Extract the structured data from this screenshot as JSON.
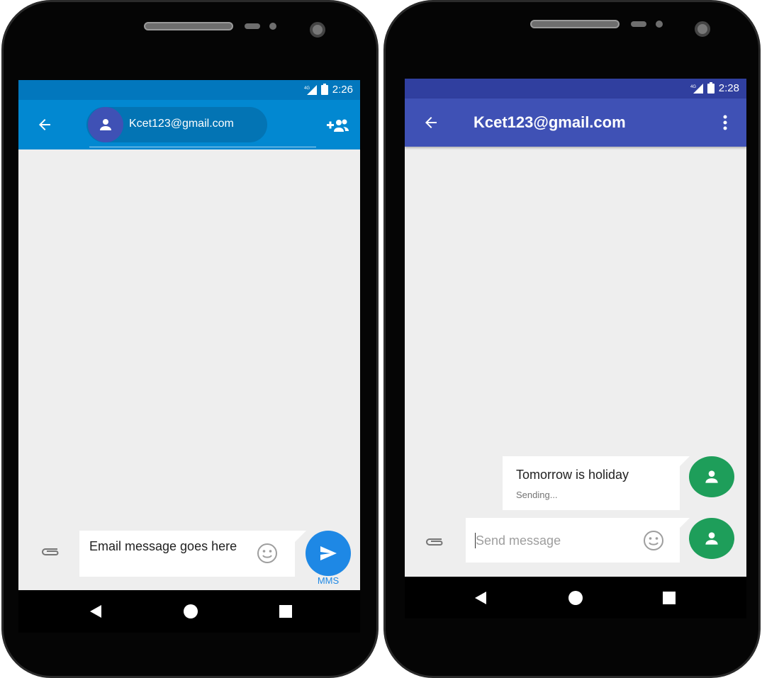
{
  "left_phone": {
    "status": {
      "network": "4G",
      "time": "2:26"
    },
    "recipient_chip": {
      "label": "Kcet123@gmail.com"
    },
    "icons": {
      "back": "arrow-left-icon",
      "add_people": "add-people-icon",
      "attach": "paperclip-icon",
      "emoji": "smiley-icon",
      "send": "send-arrow-icon"
    },
    "compose": {
      "text": "Email message goes here"
    },
    "send_button": {
      "mode_label": "MMS"
    },
    "colors": {
      "statusbar": "#0277bd",
      "appbar": "#0288d1",
      "chip": "#0374b4",
      "chip_avatar": "#3f51b5",
      "send": "#1e88e5"
    }
  },
  "right_phone": {
    "status": {
      "network": "4G",
      "time": "2:28"
    },
    "appbar": {
      "title": "Kcet123@gmail.com"
    },
    "icons": {
      "back": "arrow-left-icon",
      "overflow": "more-vert-icon",
      "attach": "paperclip-icon",
      "emoji": "smiley-icon",
      "avatar": "person-icon"
    },
    "message": {
      "text": "Tomorrow is holiday",
      "status": "Sending..."
    },
    "compose": {
      "placeholder": "Send message"
    },
    "colors": {
      "statusbar": "#303f9f",
      "appbar": "#3f51b5",
      "avatar": "#1e9e5a"
    }
  },
  "navbar": {
    "icons": [
      "back-triangle-icon",
      "home-circle-icon",
      "recents-square-icon"
    ]
  }
}
